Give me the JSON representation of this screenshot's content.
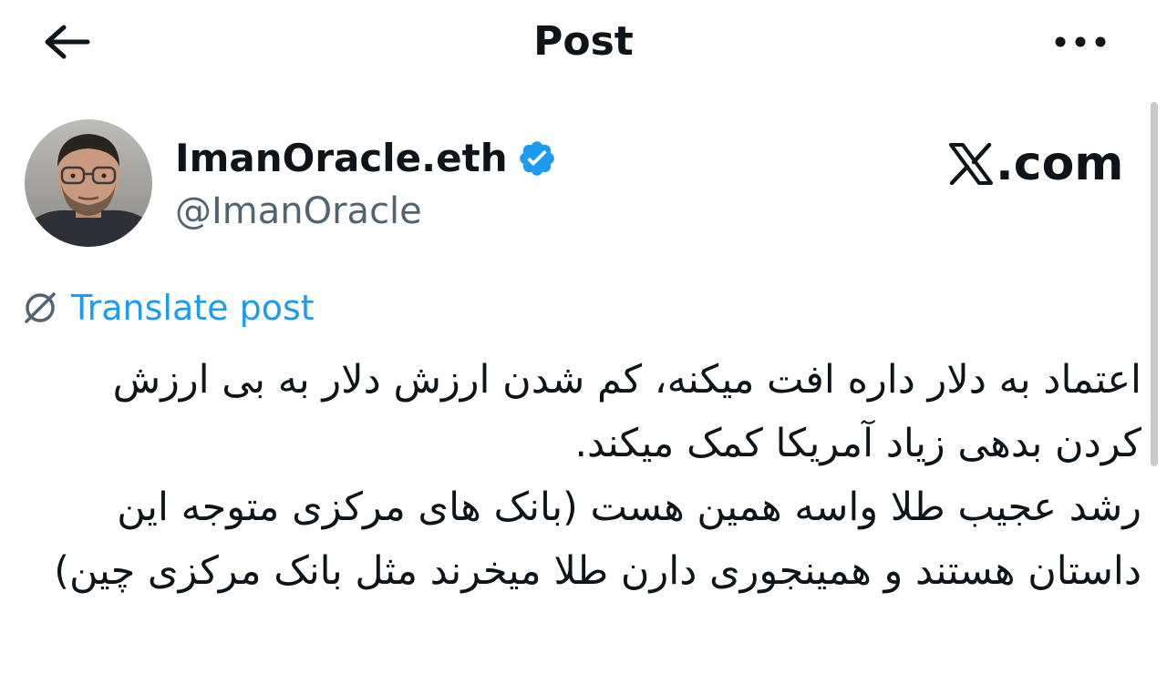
{
  "header": {
    "title": "Post",
    "back_icon": "arrow-left-icon",
    "more_icon": "more-horizontal-icon"
  },
  "author": {
    "name": "ImanOracle.eth",
    "handle": "@ImanOracle",
    "verified": true,
    "verified_color": "#1d9bf0",
    "avatar_icon": "avatar-photo"
  },
  "brand": {
    "suffix": ".com",
    "logo_icon": "x-logo-icon"
  },
  "translate": {
    "label": "Translate post",
    "icon": "globe-slash-icon",
    "color": "#1d9bf0"
  },
  "post": {
    "paragraphs": [
      "اعتماد به دلار داره افت میکنه، کم شدن ارزش دلار به بی ارزش کردن بدهی زیاد آمریکا کمک میکند.",
      "رشد عجیب طلا واسه همین هست (بانک های مرکزی متوجه این داستان هستند و همینجوری دارن طلا میخرند مثل بانک مرکزی چین)"
    ]
  }
}
